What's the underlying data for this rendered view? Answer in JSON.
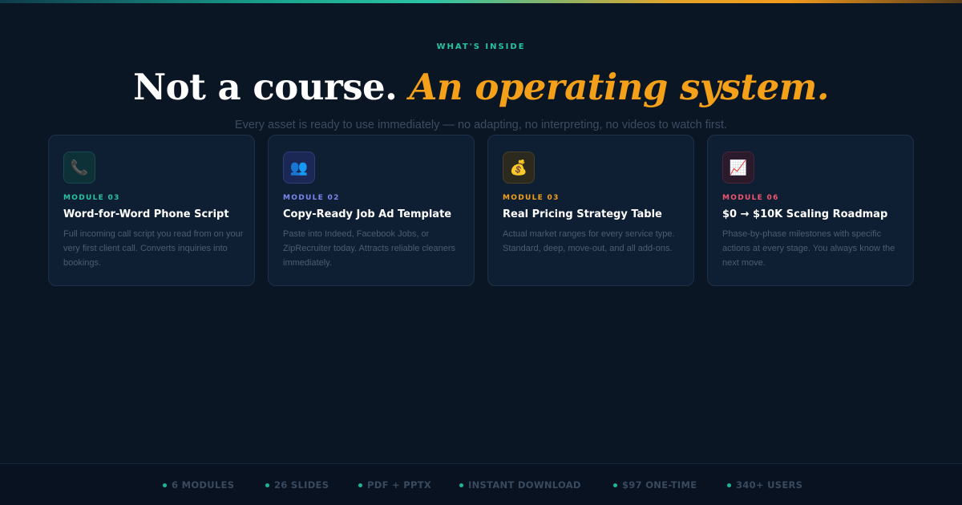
{
  "eyebrow": "WHAT'S INSIDE",
  "headline": {
    "plain": "Not a course.",
    "accent": "An operating system."
  },
  "subtitle": "Every asset is ready to use immediately — no adapting, no interpreting, no videos to watch first.",
  "cards": [
    {
      "icon": "📞",
      "icon_name": "phone-icon",
      "module": "MODULE 03",
      "title": "Word-for-Word Phone Script",
      "description": "Full incoming call script you read from on your very first client call. Converts inquiries into bookings.",
      "accent_color": "#25c4a2",
      "icon_bg": "#0e3138",
      "icon_border": "#174a4f"
    },
    {
      "icon": "👥",
      "icon_name": "people-icon",
      "module": "MODULE 02",
      "title": "Copy-Ready Job Ad Template",
      "description": "Paste into Indeed, Facebook Jobs, or ZipRecruiter today. Attracts reliable cleaners immediately.",
      "accent_color": "#7b86f0",
      "icon_bg": "#1b2754",
      "icon_border": "#2e3c78"
    },
    {
      "icon": "💰",
      "icon_name": "money-bag-icon",
      "module": "MODULE 03",
      "title": "Real Pricing Strategy Table",
      "description": "Actual market ranges for every service type. Standard, deep, move-out, and all add-ons.",
      "accent_color": "#f5a019",
      "icon_bg": "#2c2a1f",
      "icon_border": "#4a4024"
    },
    {
      "icon": "📈",
      "icon_name": "chart-increasing-icon",
      "module": "MODULE 06",
      "title": "$0 → $10K Scaling Roadmap",
      "description": "Phase-by-phase milestones with specific actions at every stage. You always know the next move.",
      "accent_color": "#f0566e",
      "icon_bg": "#2a1a2c",
      "icon_border": "#4a2638"
    }
  ],
  "footer_stats": [
    "6 MODULES",
    "26 SLIDES",
    "PDF + PPTX",
    "INSTANT DOWNLOAD",
    "$97 ONE-TIME",
    "340+ USERS"
  ],
  "colors": {
    "background": "#0b1625",
    "teal": "#25c4a2",
    "orange": "#f5a019"
  }
}
